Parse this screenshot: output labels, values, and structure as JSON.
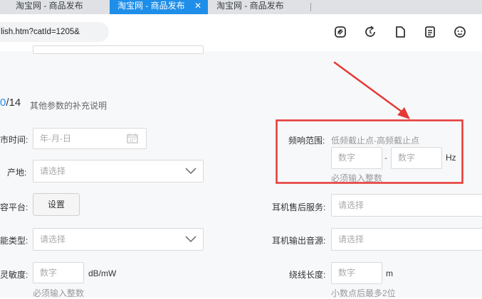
{
  "tabs": [
    {
      "label": "淘宝网 - 商品发布"
    },
    {
      "label": "淘宝网 - 商品发布"
    },
    {
      "label": "淘宝网 - 商品发布"
    }
  ],
  "tab_close": "✕",
  "address": {
    "url": "lish.htm?catId=1205&"
  },
  "section": {
    "counter_value": "0",
    "counter_total": "/14",
    "description": "其他参数的补充说明"
  },
  "fields": {
    "release_time": {
      "label": "市时间:",
      "placeholder": "年-月-日"
    },
    "origin": {
      "label": "产地:",
      "placeholder": "请选择"
    },
    "platform": {
      "label": "容平台:",
      "button": "设置"
    },
    "function_type": {
      "label": "能类型:",
      "placeholder": "请选择"
    },
    "sensitivity": {
      "label": "灵敏度:",
      "placeholder": "数字",
      "unit": "dB/mW",
      "hint": "必须输入整数"
    },
    "freq_range": {
      "label": "频响范围:",
      "desc": "低频截止点-高频截止点",
      "low_placeholder": "数字",
      "dash": "-",
      "high_placeholder": "数字",
      "unit": "Hz",
      "hint": "必须输入整数"
    },
    "after_sales": {
      "label": "耳机售后服务:",
      "placeholder": "请选择"
    },
    "output_source": {
      "label": "耳机输出音源:",
      "placeholder": "请选择"
    },
    "cable_length": {
      "label": "绕线长度:",
      "placeholder": "数字",
      "unit": "m",
      "hint": "小数点后最多2位"
    }
  },
  "colors": {
    "accent": "#1f8ee9",
    "highlight": "#e53935"
  }
}
